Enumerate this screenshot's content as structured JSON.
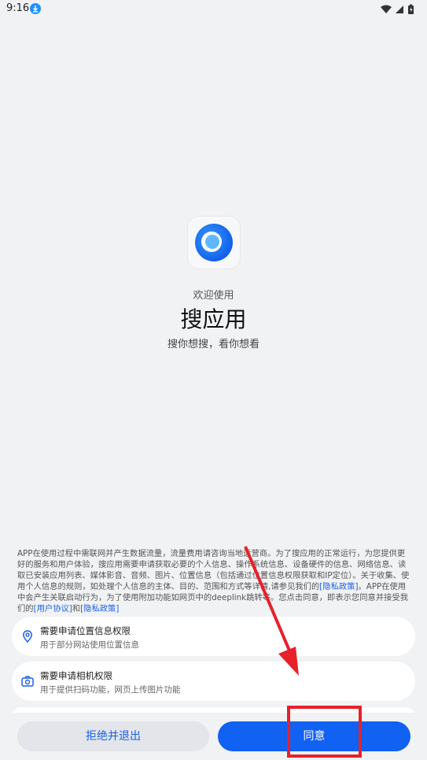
{
  "status_bar": {
    "time": "9:16",
    "download_icon": "download-icon",
    "icons": [
      "wifi-icon",
      "signal-icon",
      "battery-icon"
    ]
  },
  "welcome": {
    "greeting": "欢迎使用",
    "app_name": "搜应用",
    "slogan": "搜你想搜，看你想看",
    "logo_icon": "app-logo-icon"
  },
  "notice": {
    "p1": "APP在使用过程中需联网并产生数据流量，流量费用请咨询当地运营商。为了搜应用的正常运行，为您提供更好的服务和用户体验，搜应用需要申请获取必要的个人信息、操作系统信息、设备硬件的信息、网络信息、读取已安装应用列表、媒体影音、音频、图片、位置信息（包括通过位置信息权限获取和IP定位）。关于收集、使用个人信息的规则，如处理个人信息的主体、目的、范围和方式等详情,请参见我们的",
    "privacy_link": "[隐私政策]",
    "p2": "。APP在使用中会产生关联启动行为，为了使用附加功能如网页中的deeplink跳转等。您点击同意，即表示您同意并接受我们的",
    "user_link": "[用户协议]",
    "and": "和",
    "privacy_link2": "[隐私政策]"
  },
  "permissions": [
    {
      "icon": "location-icon",
      "title": "需要申请位置信息权限",
      "desc": "用于部分网站使用位置信息"
    },
    {
      "icon": "camera-icon",
      "title": "需要申请相机权限",
      "desc": "用于提供扫码功能，网页上传图片功能"
    }
  ],
  "buttons": {
    "reject": "拒绝并退出",
    "agree": "同意"
  },
  "colors": {
    "accent": "#1161f2",
    "annotation": "#e8202a",
    "background": "#f1f2f4"
  }
}
